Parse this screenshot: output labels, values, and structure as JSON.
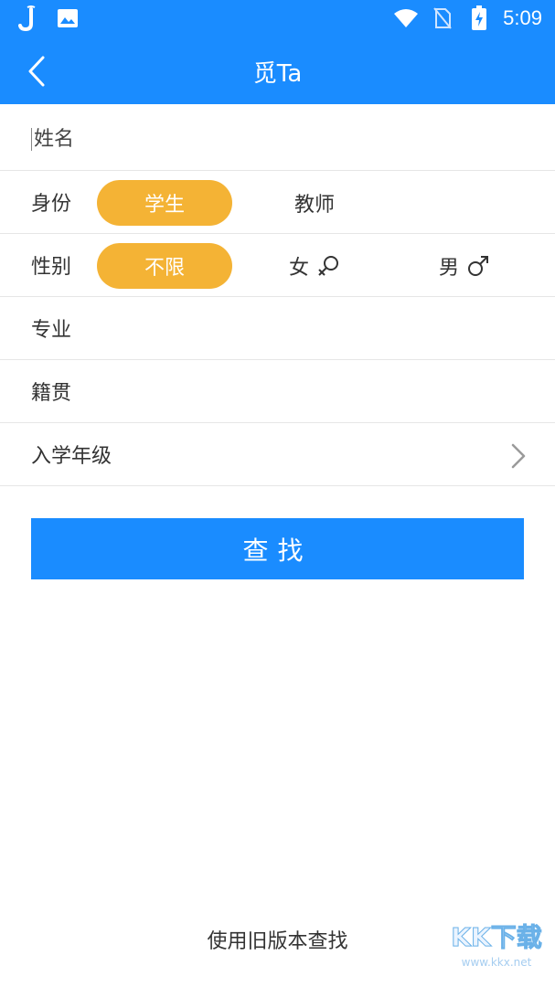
{
  "status_bar": {
    "time": "5:09",
    "left_icons": [
      "j-app-icon",
      "image-icon"
    ],
    "right_icons": [
      "wifi-icon",
      "no-sim-icon",
      "battery-charging-icon"
    ]
  },
  "app_bar": {
    "title": "觅Ta",
    "back_icon": "chevron-left-icon"
  },
  "form": {
    "name_placeholder": "姓名",
    "identity": {
      "label": "身份",
      "options": [
        "学生",
        "教师"
      ],
      "selected": "学生"
    },
    "gender": {
      "label": "性别",
      "options": [
        {
          "label": "不限",
          "icon": ""
        },
        {
          "label": "女",
          "icon": "female-icon"
        },
        {
          "label": "男",
          "icon": "male-icon"
        }
      ],
      "selected": "不限"
    },
    "major": {
      "label": "专业"
    },
    "hometown": {
      "label": "籍贯"
    },
    "enrollment": {
      "label": "入学年级",
      "icon": "chevron-right-icon"
    }
  },
  "actions": {
    "search_label": "查找",
    "old_version_label": "使用旧版本查找"
  },
  "watermark": {
    "logo_text": "KK下载",
    "url": "www.kkx.net"
  },
  "colors": {
    "primary": "#1a8cff",
    "pill_selected": "#f4b335",
    "divider": "#e6e6e6",
    "text": "#333333"
  }
}
